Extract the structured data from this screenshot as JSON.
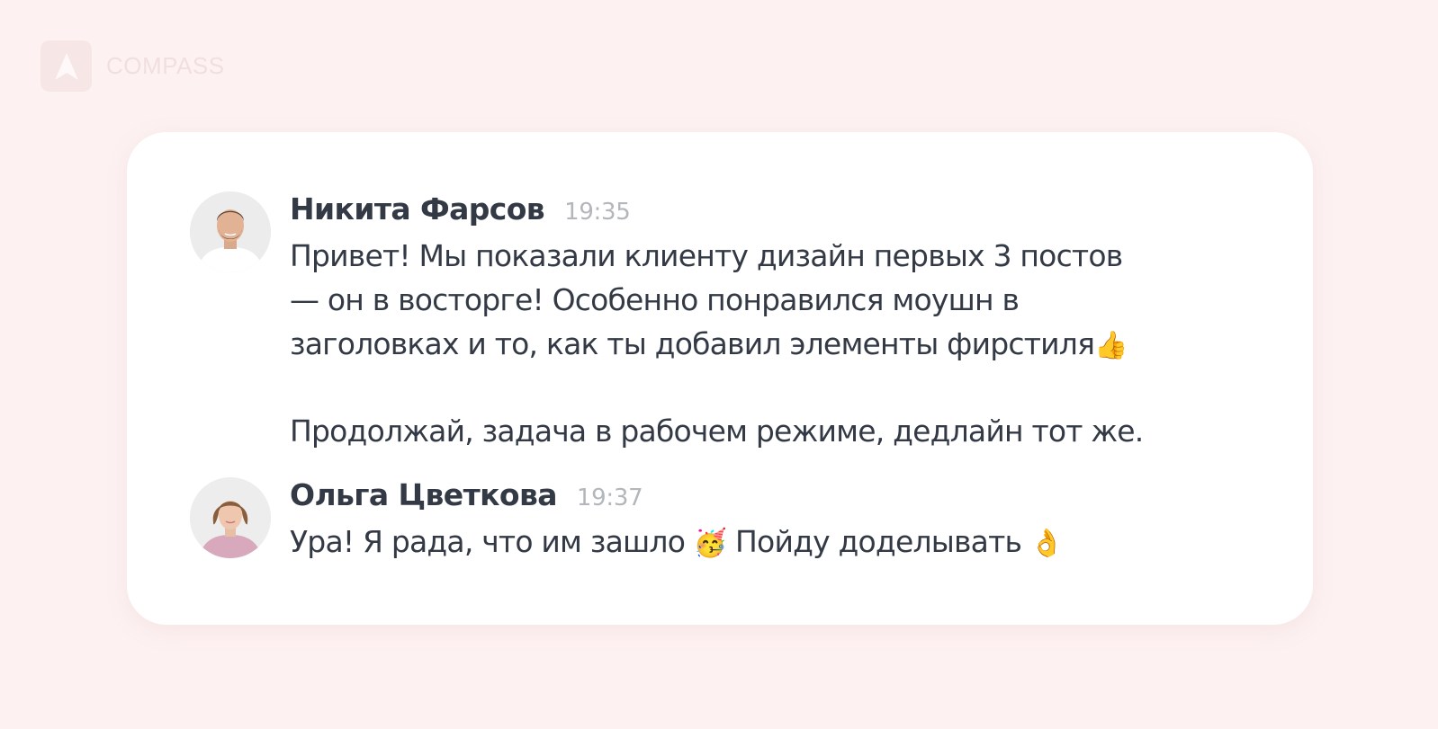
{
  "brand": {
    "name": "COMPASS",
    "logo_icon": "compass-logo-icon"
  },
  "messages": [
    {
      "author": "Никита Фарсов",
      "time": "19:35",
      "avatar_icon": "user-avatar-man",
      "paragraph_1": "Привет! Мы показали клиенту дизайн первых 3 постов\n— он в восторге! Особенно понравился моушн в\nзаголовках и то, как ты добавил элементы фирстиля",
      "emoji_1": "👍",
      "paragraph_2": "Продолжай, задача в рабочем режиме, дедлайн тот же."
    },
    {
      "author": "Ольга Цветкова",
      "time": "19:37",
      "avatar_icon": "user-avatar-woman",
      "text_1": "Ура! Я рада, что им зашло ",
      "emoji_1": "🥳",
      "text_2": " Пойду доделывать ",
      "emoji_2": "👌"
    }
  ]
}
